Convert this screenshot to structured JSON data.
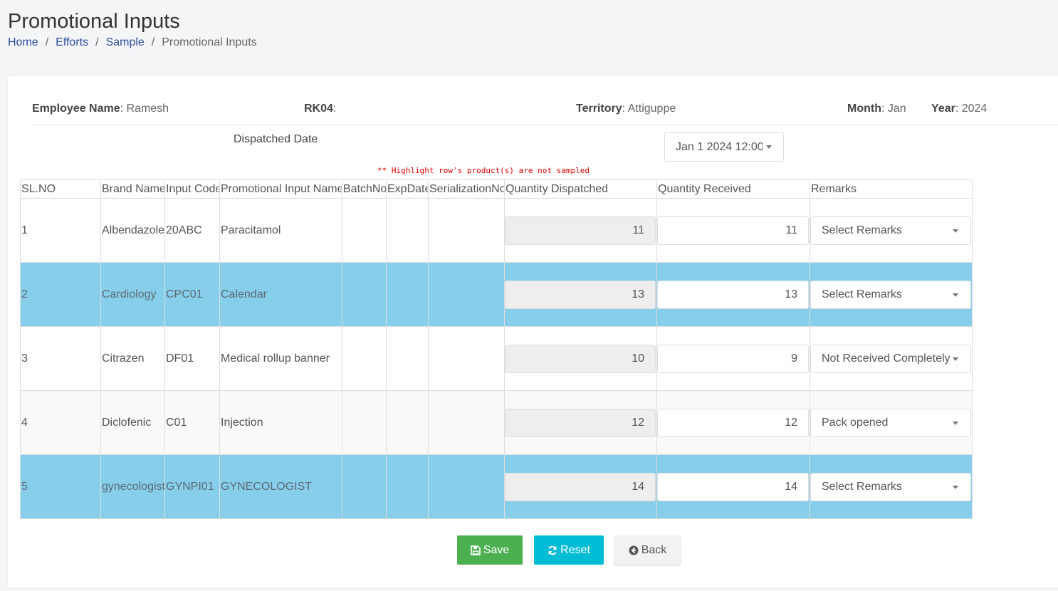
{
  "page": {
    "title": "Promotional Inputs",
    "breadcrumb": [
      "Home",
      "Efforts",
      "Sample",
      "Promotional Inputs"
    ]
  },
  "info": {
    "employee_label": "Employee Name",
    "employee_value": "Ramesh",
    "code_label": "RK04",
    "code_value": "",
    "territory_label": "Territory",
    "territory_value": "Attiguppe",
    "month_label": "Month",
    "month_value": "Jan",
    "year_label": "Year",
    "year_value": "2024"
  },
  "dispatch": {
    "label": "Dispatched Date",
    "selected": "Jan 1 2024 12:00"
  },
  "note": "** Highlight row's product(s) are not sampled",
  "table": {
    "columns": [
      "SL.NO",
      "Brand Name",
      "Input Code",
      "Promotional Input Name",
      "BatchNo",
      "ExpDate",
      "SerializationNo",
      "Quantity Dispatched",
      "Quantity Received",
      "Remarks"
    ],
    "rows": [
      {
        "sl": "1",
        "brand": "Albendazole",
        "code": "20ABC",
        "name": "Paracitamol",
        "batch": "",
        "exp": "",
        "serial": "",
        "dispatched": "11",
        "received": "11",
        "remarks": "Select Remarks",
        "highlight": false
      },
      {
        "sl": "2",
        "brand": "Cardiology",
        "code": "CPC01",
        "name": "Calendar",
        "batch": "",
        "exp": "",
        "serial": "",
        "dispatched": "13",
        "received": "13",
        "remarks": "Select Remarks",
        "highlight": true
      },
      {
        "sl": "3",
        "brand": "Citrazen",
        "code": "DF01",
        "name": "Medical rollup banner",
        "batch": "",
        "exp": "",
        "serial": "",
        "dispatched": "10",
        "received": "9",
        "remarks": "Not Received Completely",
        "highlight": false
      },
      {
        "sl": "4",
        "brand": "Diclofenic",
        "code": "C01",
        "name": "Injection",
        "batch": "",
        "exp": "",
        "serial": "",
        "dispatched": "12",
        "received": "12",
        "remarks": "Pack opened",
        "highlight": false
      },
      {
        "sl": "5",
        "brand": "gynecologist",
        "code": "GYNPI01",
        "name": "GYNECOLOGIST",
        "batch": "",
        "exp": "",
        "serial": "",
        "dispatched": "14",
        "received": "14",
        "remarks": "Select Remarks",
        "highlight": true
      }
    ]
  },
  "buttons": {
    "save": "Save",
    "reset": "Reset",
    "back": "Back"
  },
  "colors": {
    "highlight_row": "#87ceeb",
    "save": "#4cb050",
    "reset": "#00bcd4",
    "note": "#dd0000",
    "link": "#2a4d9b"
  },
  "icons": {
    "save": "floppy-disk-icon",
    "reset": "refresh-icon",
    "back": "arrow-circle-left-icon",
    "dropdown": "caret-down-icon"
  }
}
